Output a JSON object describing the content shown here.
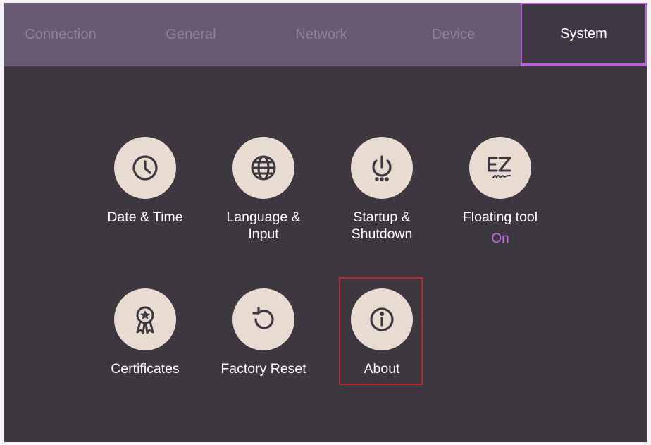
{
  "tabs": [
    {
      "label": "Connection"
    },
    {
      "label": "General"
    },
    {
      "label": "Network"
    },
    {
      "label": "Device"
    },
    {
      "label": "System",
      "active": true
    }
  ],
  "tiles": [
    {
      "label": "Date & Time",
      "icon": "clock-icon"
    },
    {
      "label": "Language & Input",
      "icon": "globe-icon"
    },
    {
      "label": "Startup & Shutdown",
      "icon": "power-icon"
    },
    {
      "label": "Floating tool",
      "status": "On",
      "icon": "ez-icon"
    },
    {
      "label": "Certificates",
      "icon": "award-ribbon-icon"
    },
    {
      "label": "Factory Reset",
      "icon": "reset-icon"
    },
    {
      "label": "About",
      "icon": "info-icon"
    }
  ],
  "colors": {
    "tabbar": "#675a72",
    "background": "#3d3740",
    "accent": "#b565d6",
    "icon_circle": "#e8dbd1",
    "icon_stroke": "#3d3740",
    "highlight": "#c0252c"
  }
}
